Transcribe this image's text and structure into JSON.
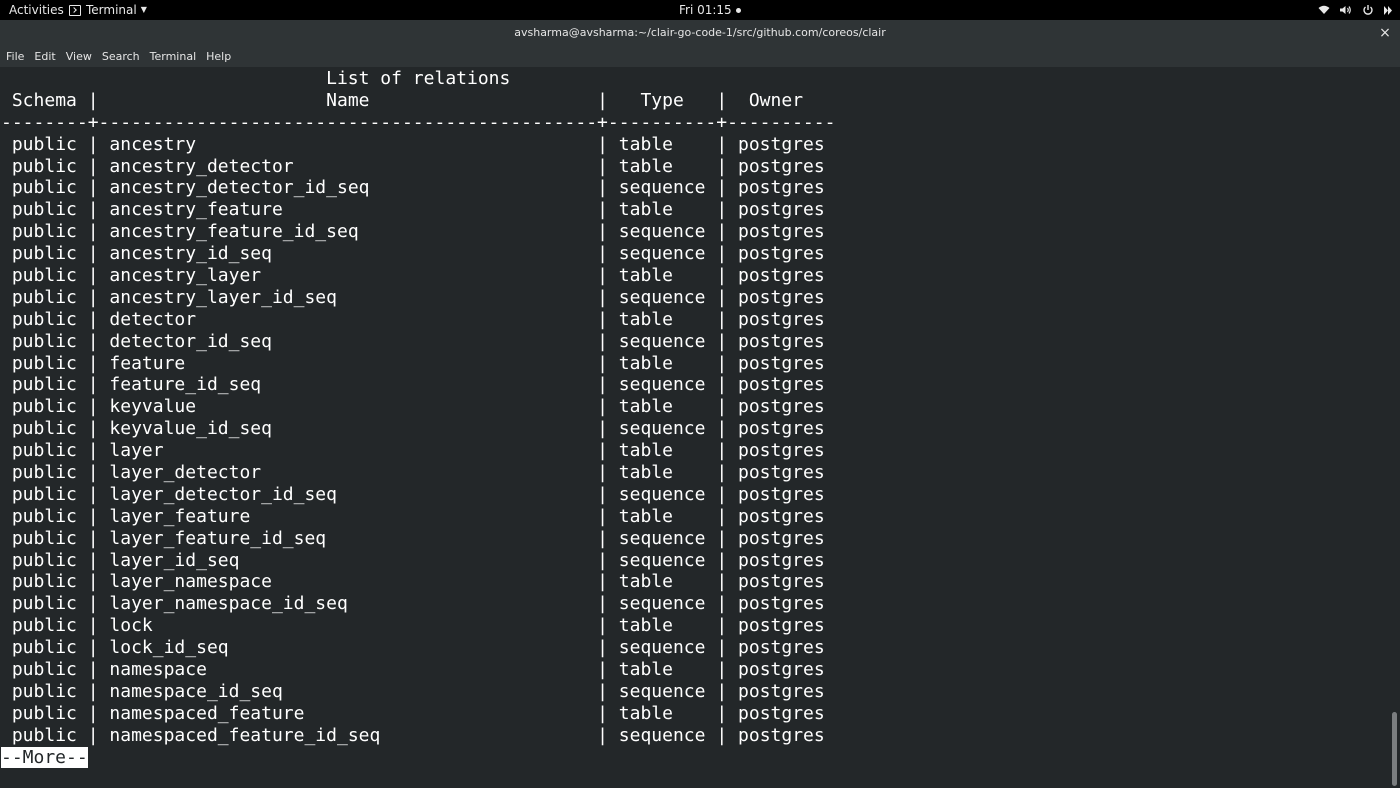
{
  "topbar": {
    "activities": "Activities",
    "app_name": "Terminal",
    "clock": "Fri 01:15",
    "icons": [
      "wifi-icon",
      "volume-icon",
      "power-icon",
      "battery-icon"
    ]
  },
  "window": {
    "title": "avsharma@avsharma:~/clair-go-code-1/src/github.com/coreos/clair",
    "close_glyph": "×"
  },
  "menubar": {
    "items": [
      "File",
      "Edit",
      "View",
      "Search",
      "Terminal",
      "Help"
    ]
  },
  "terminal": {
    "caption": "List of relations",
    "columns": [
      "Schema",
      "Name",
      "Type",
      "Owner"
    ],
    "rows": [
      [
        "public",
        "ancestry",
        "table",
        "postgres"
      ],
      [
        "public",
        "ancestry_detector",
        "table",
        "postgres"
      ],
      [
        "public",
        "ancestry_detector_id_seq",
        "sequence",
        "postgres"
      ],
      [
        "public",
        "ancestry_feature",
        "table",
        "postgres"
      ],
      [
        "public",
        "ancestry_feature_id_seq",
        "sequence",
        "postgres"
      ],
      [
        "public",
        "ancestry_id_seq",
        "sequence",
        "postgres"
      ],
      [
        "public",
        "ancestry_layer",
        "table",
        "postgres"
      ],
      [
        "public",
        "ancestry_layer_id_seq",
        "sequence",
        "postgres"
      ],
      [
        "public",
        "detector",
        "table",
        "postgres"
      ],
      [
        "public",
        "detector_id_seq",
        "sequence",
        "postgres"
      ],
      [
        "public",
        "feature",
        "table",
        "postgres"
      ],
      [
        "public",
        "feature_id_seq",
        "sequence",
        "postgres"
      ],
      [
        "public",
        "keyvalue",
        "table",
        "postgres"
      ],
      [
        "public",
        "keyvalue_id_seq",
        "sequence",
        "postgres"
      ],
      [
        "public",
        "layer",
        "table",
        "postgres"
      ],
      [
        "public",
        "layer_detector",
        "table",
        "postgres"
      ],
      [
        "public",
        "layer_detector_id_seq",
        "sequence",
        "postgres"
      ],
      [
        "public",
        "layer_feature",
        "table",
        "postgres"
      ],
      [
        "public",
        "layer_feature_id_seq",
        "sequence",
        "postgres"
      ],
      [
        "public",
        "layer_id_seq",
        "sequence",
        "postgres"
      ],
      [
        "public",
        "layer_namespace",
        "table",
        "postgres"
      ],
      [
        "public",
        "layer_namespace_id_seq",
        "sequence",
        "postgres"
      ],
      [
        "public",
        "lock",
        "table",
        "postgres"
      ],
      [
        "public",
        "lock_id_seq",
        "sequence",
        "postgres"
      ],
      [
        "public",
        "namespace",
        "table",
        "postgres"
      ],
      [
        "public",
        "namespace_id_seq",
        "sequence",
        "postgres"
      ],
      [
        "public",
        "namespaced_feature",
        "table",
        "postgres"
      ],
      [
        "public",
        "namespaced_feature_id_seq",
        "sequence",
        "postgres"
      ]
    ],
    "pager_prompt": "--More--"
  },
  "colors": {
    "terminal_bg": "#232729",
    "terminal_fg": "#ffffff",
    "titlebar_bg": "#2f3436",
    "topbar_bg": "#000000"
  }
}
